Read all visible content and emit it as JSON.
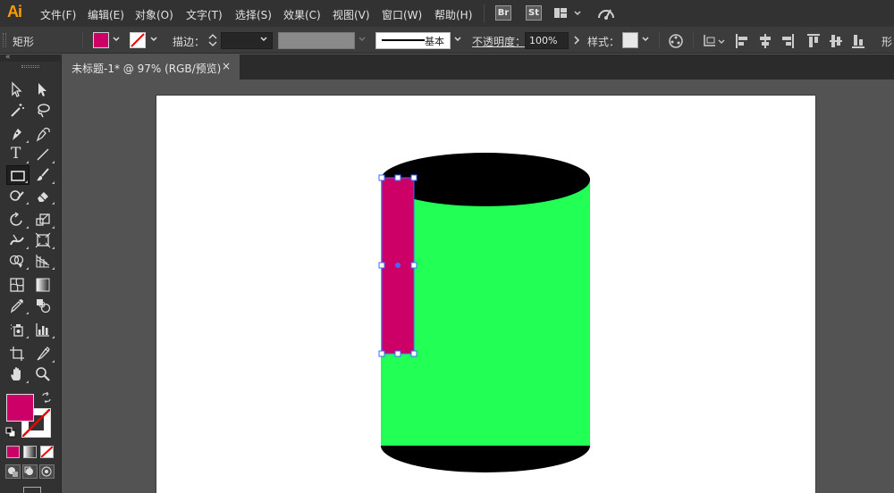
{
  "app": {
    "logo": "Ai"
  },
  "menu": {
    "items": [
      "文件(F)",
      "编辑(E)",
      "对象(O)",
      "文字(T)",
      "选择(S)",
      "效果(C)",
      "视图(V)",
      "窗口(W)",
      "帮助(H)"
    ],
    "bridge_label": "Br",
    "stock_label": "St",
    "icons": [
      "workspace-switcher-icon",
      "gpu-performance-icon"
    ]
  },
  "control_bar": {
    "object_type": "矩形",
    "fill_color": "#cc0066",
    "stroke_label": "描边：",
    "stroke_weight": "",
    "stroke_profile": "基本",
    "opacity_label": "不透明度：",
    "opacity_value": "100%",
    "style_label": "样式：",
    "shape_label": "形"
  },
  "document": {
    "tab_title": "未标题-1* @ 97% (RGB/预览)",
    "close_glyph": "×"
  },
  "tools": [
    "selection-tool",
    "direct-selection-tool",
    "magic-wand-tool",
    "lasso-tool",
    "pen-tool",
    "curvature-tool",
    "type-tool",
    "line-segment-tool",
    "rectangle-tool",
    "paintbrush-tool",
    "shaper-tool",
    "eraser-tool",
    "rotate-tool",
    "scale-tool",
    "width-tool",
    "free-transform-tool",
    "shape-builder-tool",
    "perspective-grid-tool",
    "mesh-tool",
    "gradient-tool",
    "eyedropper-tool",
    "blend-tool",
    "symbol-sprayer-tool",
    "column-graph-tool",
    "artboard-tool",
    "slice-tool",
    "hand-tool",
    "zoom-tool"
  ],
  "tool_text": {
    "type_glyph": "T"
  },
  "colors": {
    "fill": "#cc0066",
    "stroke": "none",
    "cylinder_body": "#22ff55",
    "cylinder_caps": "#000000",
    "selected_rect": "#cc0066",
    "selection": "#3d6bff",
    "accent_logo": "#ff9a00"
  }
}
